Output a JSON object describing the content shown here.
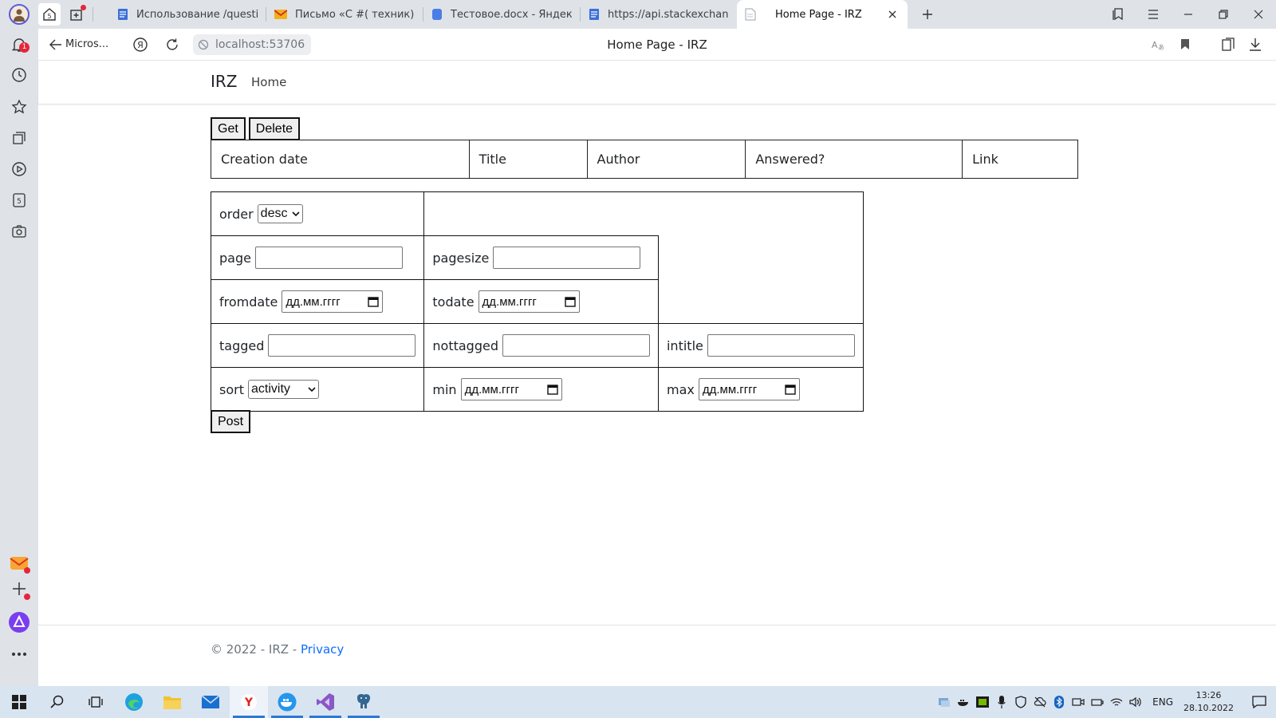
{
  "browser": {
    "tabs": [
      {
        "label": "Использование /question",
        "icon": "doc-icon",
        "color": "#3b6fd8"
      },
      {
        "label": "Письмо «С #( техник), Юр",
        "icon": "mail-icon",
        "color": "#f2b01e"
      },
      {
        "label": "Тестовое.docx - Яндекс.Д",
        "icon": "disk-icon",
        "color": "#4a7de8"
      },
      {
        "label": "https://api.stackexchange.c",
        "icon": "doc-icon",
        "color": "#3b6fd8"
      },
      {
        "label": "Home Page - IRZ",
        "icon": "page-icon",
        "active": true
      }
    ],
    "back_label": "Micros...",
    "url": "localhost:53706",
    "page_title": "Home Page - IRZ",
    "sidebar_badge": "1"
  },
  "page": {
    "brand": "IRZ",
    "nav_home": "Home",
    "buttons": {
      "get": "Get",
      "delete": "Delete",
      "post": "Post"
    },
    "columns": [
      "Creation date",
      "Title",
      "Author",
      "Answered?",
      "Link"
    ],
    "form": {
      "order_label": "order",
      "order_value": "desc",
      "page_label": "page",
      "pagesize_label": "pagesize",
      "fromdate_label": "fromdate",
      "todate_label": "todate",
      "date_placeholder": "дд.мм.гггг",
      "tagged_label": "tagged",
      "nottagged_label": "nottagged",
      "intitle_label": "intitle",
      "sort_label": "sort",
      "sort_value": "activity",
      "min_label": "min",
      "max_label": "max"
    },
    "footer": {
      "copyright": "© 2022 - IRZ - ",
      "privacy": "Privacy"
    }
  },
  "taskbar": {
    "lang": "ENG",
    "time": "13:26",
    "date": "28.10.2022"
  },
  "colors": {
    "link": "#0d6efd",
    "accent": "#2b78d6",
    "badge": "#e5263a"
  }
}
